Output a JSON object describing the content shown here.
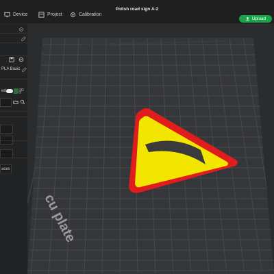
{
  "window": {
    "title": "Polish road sign A-2"
  },
  "tabs": [
    {
      "label": "Device",
      "icon": "monitor-icon"
    },
    {
      "label": "Project",
      "icon": "project-icon"
    },
    {
      "label": "Calibration",
      "icon": "calibration-icon"
    }
  ],
  "actions": {
    "upload_label": "Upload",
    "upload_icon": "upload-icon"
  },
  "sidebar": {
    "filament_label": "PLA Basic",
    "toggle_label": "ed",
    "option_label": "aces"
  },
  "viewport": {
    "plate_label": "cu plate"
  },
  "colors": {
    "accent_green": "#19a34a",
    "sign_yellow": "#f2e500",
    "sign_red": "#e01c1c",
    "curve_dark": "#3a3a3a"
  }
}
